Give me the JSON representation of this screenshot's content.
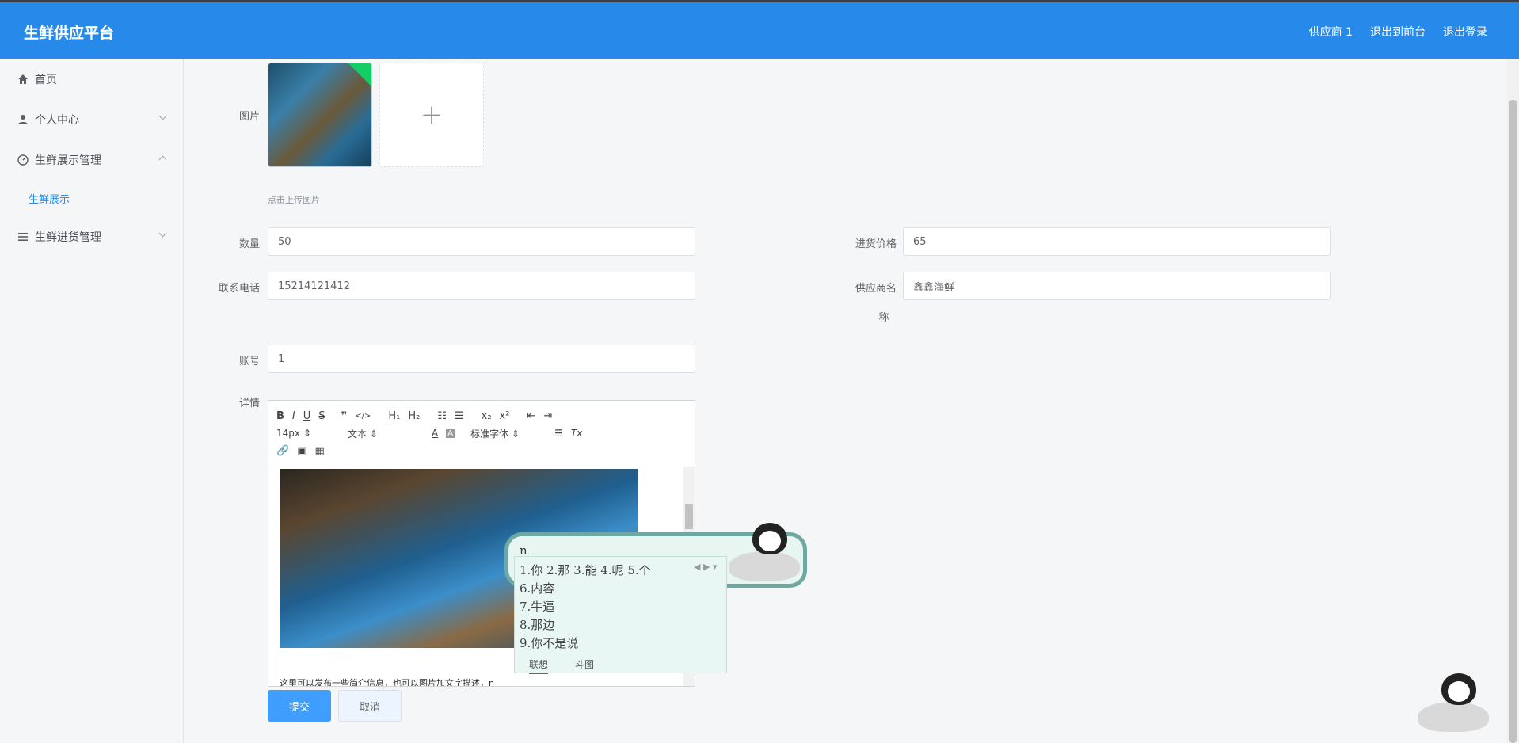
{
  "header": {
    "brand": "生鲜供应平台",
    "user": "供应商 1",
    "back_to_front": "退出到前台",
    "logout": "退出登录"
  },
  "sidebar": {
    "items": [
      {
        "label": "首页",
        "icon": "home-icon"
      },
      {
        "label": "个人中心",
        "icon": "user-icon"
      },
      {
        "label": "生鲜展示管理",
        "icon": "gauge-icon"
      },
      {
        "label": "生鲜进货管理",
        "icon": "list-icon"
      }
    ],
    "sub_item": "生鲜展示"
  },
  "form": {
    "image_label": "图片",
    "upload_tip": "点击上传图片",
    "quantity_label": "数量",
    "quantity_value": "50",
    "price_label": "进货价格",
    "price_value": "65",
    "phone_label": "联系电话",
    "phone_value": "15214121412",
    "supplier_label_1": "供应商名",
    "supplier_label_2": "称",
    "supplier_value": "鑫鑫海鲜",
    "account_label": "账号",
    "account_value": "1",
    "detail_label": "详情"
  },
  "editor": {
    "font_size": "14px",
    "header_select": "文本",
    "font_family": "标准字体",
    "text": "这里可以发布一些简介信息，也可以图片加文字描述，n"
  },
  "buttons": {
    "submit": "提交",
    "cancel": "取消"
  },
  "ime": {
    "composition": "n",
    "row1": "1.你  2.那  3.能  4.呢  5.个",
    "row6": "6.内容",
    "row7": "7.牛逼",
    "row8": "8.那边",
    "row9": "9.你不是说",
    "tab_assoc": "联想",
    "tab_meme": "斗图"
  }
}
